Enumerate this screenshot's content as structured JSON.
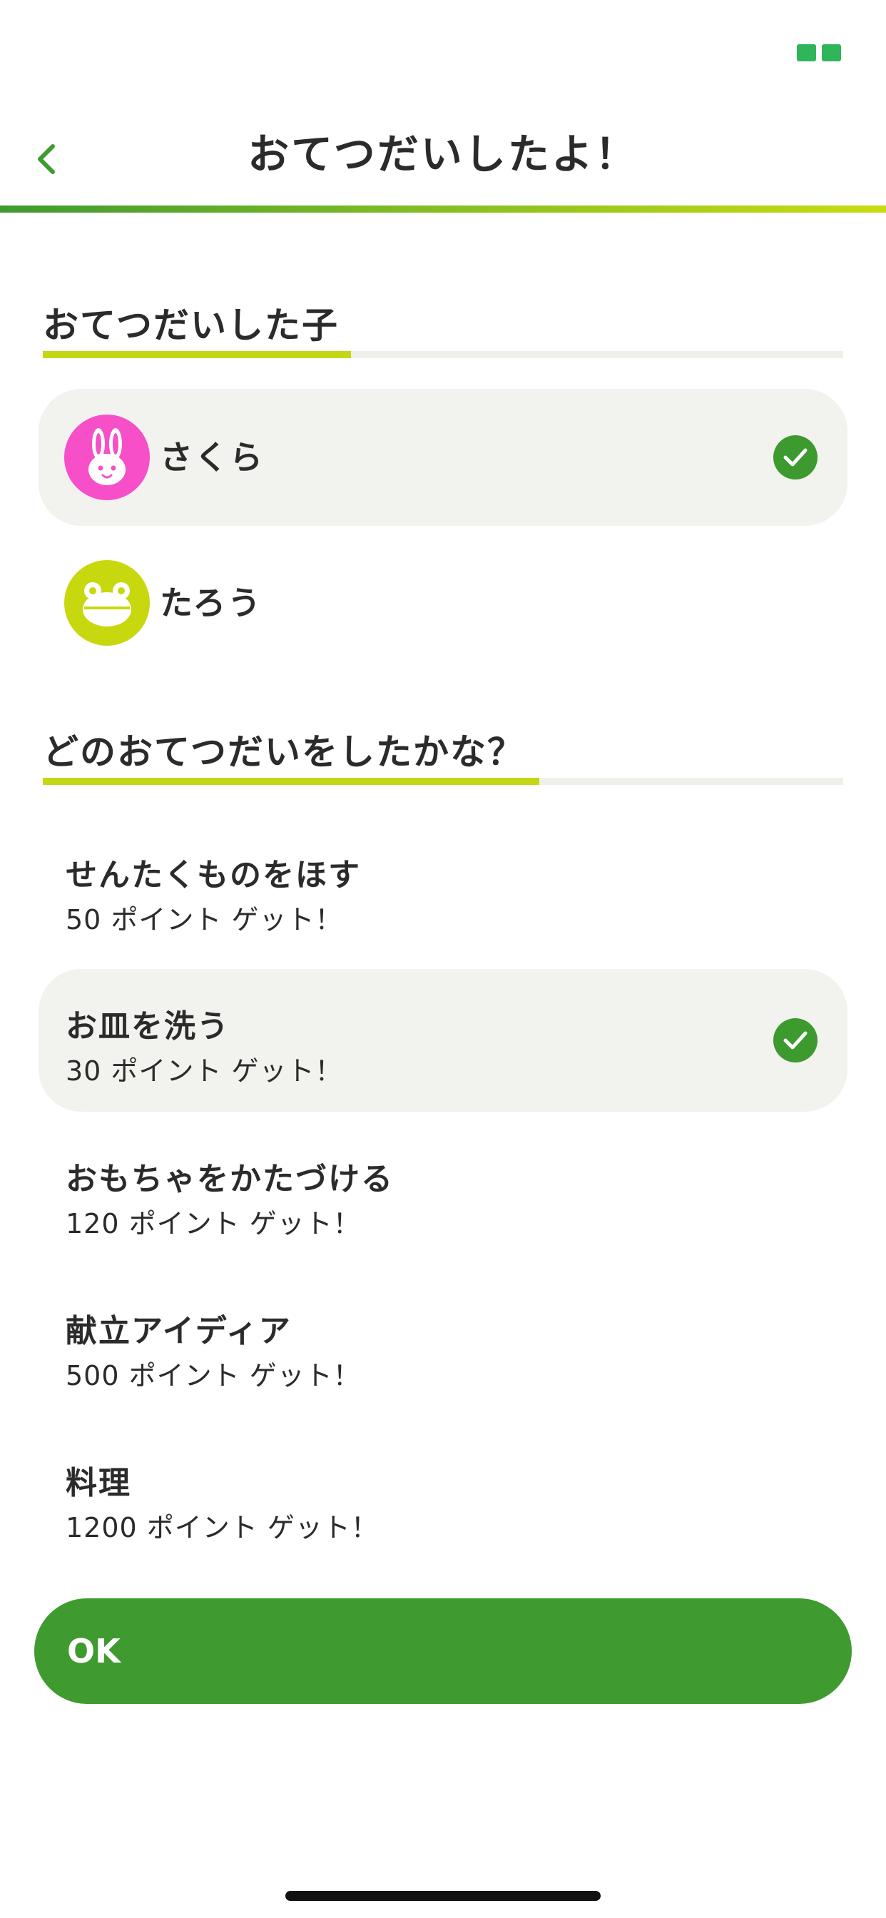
{
  "header": {
    "title": "おてつだいしたよ！",
    "back_icon": "chevron-left-icon"
  },
  "children_section": {
    "heading": "おてつだいした子",
    "children": [
      {
        "name": "さくら",
        "avatar_icon": "rabbit-icon",
        "avatar_color": "#f64fc8",
        "selected": true
      },
      {
        "name": "たろう",
        "avatar_icon": "frog-icon",
        "avatar_color": "#c7d80f",
        "selected": false
      }
    ]
  },
  "tasks_section": {
    "heading": "どのおてつだいをしたかな？",
    "tasks": [
      {
        "name": "せんたくものをほす",
        "points": "50 ポイント ゲット！",
        "selected": false
      },
      {
        "name": "お皿を洗う",
        "points": "30 ポイント ゲット！",
        "selected": true
      },
      {
        "name": "おもちゃをかたづける",
        "points": "120 ポイント ゲット！",
        "selected": false
      },
      {
        "name": "献立アイディア",
        "points": "500 ポイント ゲット！",
        "selected": false
      },
      {
        "name": "料理",
        "points": "1200 ポイント ゲット！",
        "selected": false
      }
    ]
  },
  "ok_button": {
    "label": "OK"
  },
  "colors": {
    "primary_green": "#3f9a30",
    "accent_lime": "#c3d715",
    "selected_bg": "#f2f2ee",
    "check_green": "#3c9a2f"
  }
}
